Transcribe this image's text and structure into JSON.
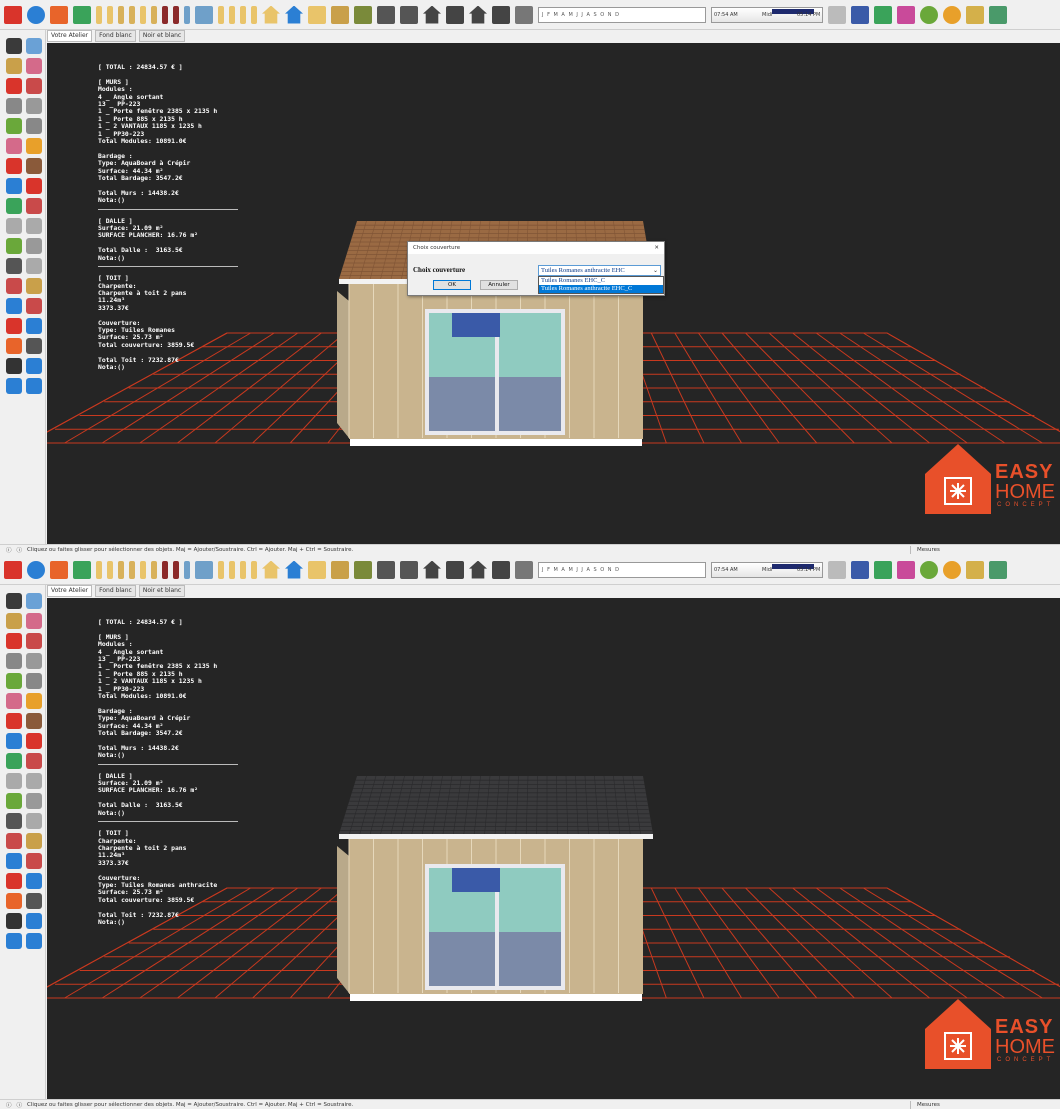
{
  "colors": {
    "accent": "#e8502a",
    "viewport_bg": "#252525",
    "grid": "#c8391f",
    "roof_brown": "#9a6a43",
    "roof_dark": "#3a3a3c"
  },
  "toolbar": {
    "shadow_months": "J F M A M J J A S O N D",
    "time_start": "07:54 AM",
    "time_mid": "Midi",
    "time_end": "05:14 PM"
  },
  "tabs": [
    "Votre Atelier",
    "Fond blanc",
    "Noir et blanc"
  ],
  "status": {
    "text": "Cliquez ou faites glisser pour sélectionner des objets. Maj = Ajouter/Soustraire. Ctrl = Ajouter. Maj + Ctrl = Soustraire.",
    "measures_label": "Mesures"
  },
  "dialog": {
    "title": "Choix couverture",
    "label": "Choix couverture",
    "selected": "Tuiles Romanes anthracite EHC",
    "options": [
      "Tuiles Romanes EHC_C",
      "Tuiles Romanes anthracite EHC_C"
    ],
    "ok": "OK",
    "cancel": "Annuler"
  },
  "logo": {
    "line1": "EASY",
    "line2": "HOME",
    "line3": "CONCEPT"
  },
  "panel1": {
    "lines": [
      "[ TOTAL : 24834.57 € ]",
      "",
      "[ MURS ]",
      "Modules :",
      "4 _ Angle sortant",
      "13 _ PP-223",
      "1 _ Porte fenêtre 2385 x 2135 h",
      "1 _ Porte 885 x 2135 h",
      "1 _ 2 VANTAUX 1185 x 1235 h",
      "1 _ PP30-223",
      "Total Modules: 10891.0€",
      "",
      "Bardage :",
      "Type: AquaBoard à Crépir",
      "Surface: 44.34 m²",
      "Total Bardage: 3547.2€",
      "",
      "Total Murs : 14438.2€",
      "Nota:()"
    ],
    "dalle": [
      "[ DALLE ]",
      "Surface: 21.09 m²",
      "SURFACE PLANCHER: 16.76 m²",
      "",
      "Total Dalle :  3163.5€",
      "Nota:()"
    ],
    "toit": [
      "[ TOIT ]",
      "Charpente:",
      "Charpente à toit 2 pans",
      "11.24m³",
      "3373.37€",
      "",
      "Couverture:",
      "Type: Tuiles Romanes",
      "Surface: 25.73 m²",
      "Total couverture: 3859.5€",
      "",
      "Total Toit : 7232.87€",
      "Nota:()"
    ]
  },
  "panel2": {
    "lines": [
      "[ TOTAL : 24834.57 € ]",
      "",
      "[ MURS ]",
      "Modules :",
      "4 _ Angle sortant",
      "13 _ PP-223",
      "1 _ Porte fenêtre 2385 x 2135 h",
      "1 _ Porte 885 x 2135 h",
      "1 _ 2 VANTAUX 1185 x 1235 h",
      "1 _ PP30-223",
      "Total Modules: 10891.0€",
      "",
      "Bardage :",
      "Type: AquaBoard à Crépir",
      "Surface: 44.34 m²",
      "Total Bardage: 3547.2€",
      "",
      "Total Murs : 14438.2€",
      "Nota:()"
    ],
    "dalle": [
      "[ DALLE ]",
      "Surface: 21.09 m²",
      "SURFACE PLANCHER: 16.76 m²",
      "",
      "Total Dalle :  3163.5€",
      "Nota:()"
    ],
    "toit": [
      "[ TOIT ]",
      "Charpente:",
      "Charpente à toit 2 pans",
      "11.24m³",
      "3373.37€",
      "",
      "Couverture:",
      "Type: Tuiles Romanes anthracite",
      "Surface: 25.73 m²",
      "Total couverture: 3859.5€",
      "",
      "Total Toit : 7232.87€",
      "Nota:()"
    ]
  }
}
